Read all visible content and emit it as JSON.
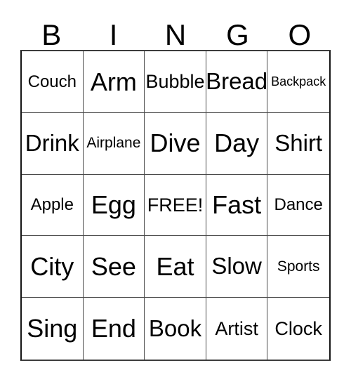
{
  "card": {
    "header_letters": [
      "B",
      "I",
      "N",
      "G",
      "O"
    ],
    "free_space_label": "FREE!",
    "border_color": "#151515",
    "grid_line_color": "#4a4a4a",
    "text_color": "#000000",
    "background_color": "#ffffff",
    "rows": [
      [
        {
          "label": "Couch",
          "size": "sm"
        },
        {
          "label": "Arm",
          "size": "xl"
        },
        {
          "label": "Bubble",
          "size": "md"
        },
        {
          "label": "Bread",
          "size": "lg"
        },
        {
          "label": "Backpack",
          "size": "xxs"
        }
      ],
      [
        {
          "label": "Drink",
          "size": "lg"
        },
        {
          "label": "Airplane",
          "size": "xs"
        },
        {
          "label": "Dive",
          "size": "xl"
        },
        {
          "label": "Day",
          "size": "xl"
        },
        {
          "label": "Shirt",
          "size": "lg"
        }
      ],
      [
        {
          "label": "Apple",
          "size": "sm"
        },
        {
          "label": "Egg",
          "size": "xl"
        },
        {
          "label": "FREE!",
          "size": "md"
        },
        {
          "label": "Fast",
          "size": "xl"
        },
        {
          "label": "Dance",
          "size": "sm"
        }
      ],
      [
        {
          "label": "City",
          "size": "xl"
        },
        {
          "label": "See",
          "size": "xl"
        },
        {
          "label": "Eat",
          "size": "xl"
        },
        {
          "label": "Slow",
          "size": "lg"
        },
        {
          "label": "Sports",
          "size": "xs"
        }
      ],
      [
        {
          "label": "Sing",
          "size": "xl"
        },
        {
          "label": "End",
          "size": "xl"
        },
        {
          "label": "Book",
          "size": "lg"
        },
        {
          "label": "Artist",
          "size": "md"
        },
        {
          "label": "Clock",
          "size": "md"
        }
      ]
    ]
  }
}
